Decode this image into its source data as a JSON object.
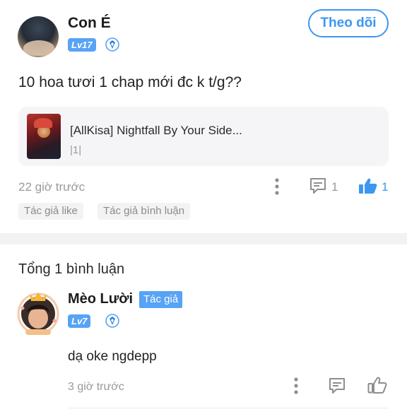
{
  "post": {
    "author": {
      "name": "Con É",
      "level": "Lv17",
      "avatar": "avatar"
    },
    "follow_label": "Theo dõi",
    "text": "10 hoa tươi 1 chap mới đc k t/g??",
    "linked_story": {
      "title": "[AllKisa] Nightfall By Your Side...",
      "chapter": "|1|"
    },
    "time": "22 giờ trước",
    "comment_count": "1",
    "like_count": "1",
    "tags": [
      "Tác giả like",
      "Tác giả bình luận"
    ]
  },
  "comments": {
    "total_label": "Tổng 1 bình luận",
    "items": [
      {
        "name": "Mèo Lười",
        "author_badge": "Tác giả",
        "level": "Lv7",
        "text": "dạ oke ngdepp",
        "time": "3 giờ trước"
      }
    ]
  },
  "icons": {
    "more": "more-vertical-icon",
    "comment": "comment-icon",
    "like": "thumbs-up-icon",
    "verified": "shield-icon"
  },
  "colors": {
    "accent": "#3c97f0",
    "badge": "#57a3f5",
    "muted": "#9a9a9a"
  }
}
